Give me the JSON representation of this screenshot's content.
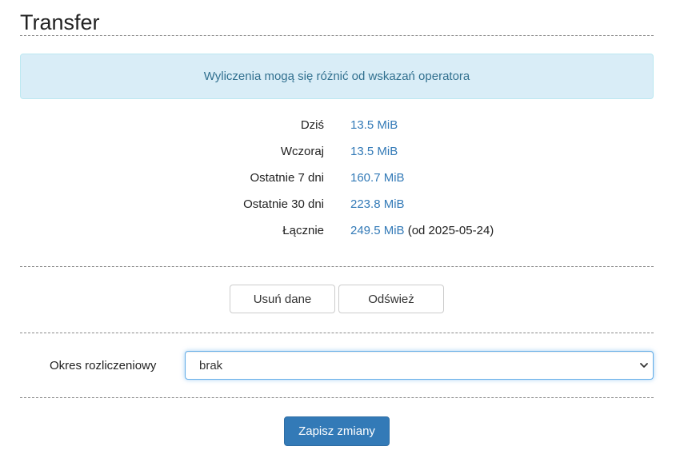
{
  "header": {
    "title": "Transfer"
  },
  "alert": {
    "text": "Wyliczenia mogą się różnić od wskazań operatora"
  },
  "stats": [
    {
      "label": "Dziś",
      "value": "13.5 MiB",
      "extra": ""
    },
    {
      "label": "Wczoraj",
      "value": "13.5 MiB",
      "extra": ""
    },
    {
      "label": "Ostatnie 7 dni",
      "value": "160.7 MiB",
      "extra": ""
    },
    {
      "label": "Ostatnie 30 dni",
      "value": "223.8 MiB",
      "extra": ""
    },
    {
      "label": "Łącznie",
      "value": "249.5 MiB",
      "extra": " (od 2025-05-24)"
    }
  ],
  "actions": {
    "delete_label": "Usuń dane",
    "refresh_label": "Odśwież"
  },
  "billing": {
    "label": "Okres rozliczeniowy",
    "selected": "brak"
  },
  "footer": {
    "save_label": "Zapisz zmiany"
  },
  "colors": {
    "accent": "#337ab7",
    "alert_bg": "#d9edf7",
    "alert_text": "#31708f"
  },
  "icons": {
    "select": "chevron-down-icon"
  }
}
